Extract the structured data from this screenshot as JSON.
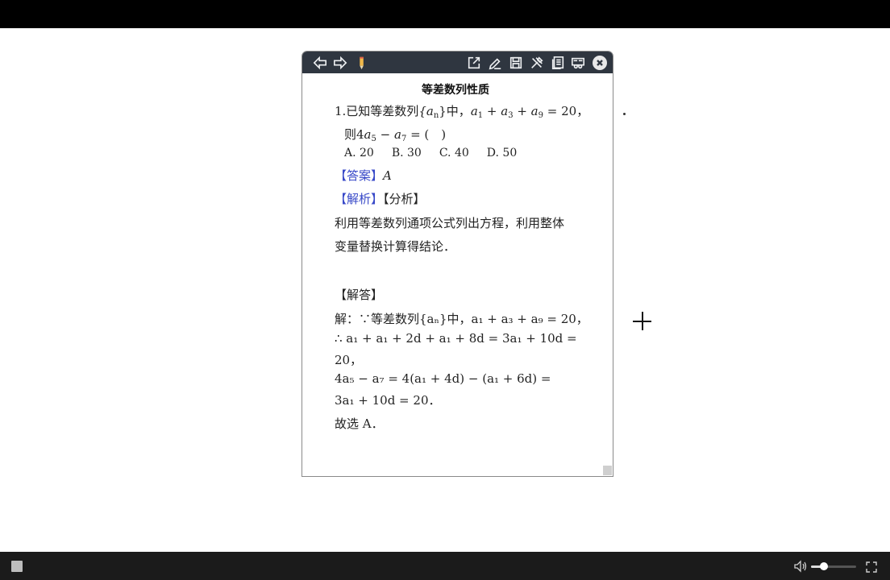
{
  "popup": {
    "toolbar_icons": [
      "arrow-left-icon",
      "arrow-right-icon",
      "pencil-icon",
      "open-external-icon",
      "edit-icon",
      "save-icon",
      "tools-icon",
      "notes-icon",
      "glasses-icon",
      "close-icon"
    ],
    "title": "等差数列性质",
    "q_prefix": "1.已知等差数列",
    "q_seq": "{a",
    "q_seq_sub": "n",
    "q_seq_end": "}中，",
    "q_eq_a": "a",
    "q_eq_1": "1",
    "q_eq_plus1": " + a",
    "q_eq_3": "3",
    "q_eq_plus2": " + a",
    "q_eq_9": "9",
    "q_eq_rhs": " = 20，",
    "q2_prefix": "则4",
    "q2_a": "a",
    "q2_5": "5",
    "q2_minus": " − a",
    "q2_7": "7",
    "q2_rhs": " = (　)",
    "options": [
      "A. 20",
      "B. 30",
      "C. 40",
      "D. 50"
    ],
    "answer_tag": "【答案】",
    "answer_value": "A",
    "analysis_tag": "【解析】",
    "analysis_sub": "【分析】",
    "analysis_line1": "利用等差数列通项公式列出方程，利用整体",
    "analysis_line2": "变量替换计算得结论．",
    "solution_tag": "【解答】",
    "sol_line1": "解：∵等差数列{aₙ}中，a₁ + a₃ + a₉ = 20，",
    "sol_line2": "∴ a₁ + a₁ + 2d + a₁ + 8d = 3a₁ + 10d =",
    "sol_line3": "20，",
    "sol_line4": "4a₅ − a₇ = 4(a₁ + 4d) − (a₁ + 6d) =",
    "sol_line5": "3a₁ + 10d = 20．",
    "sol_line6": "故选 A．"
  },
  "player": {
    "volume_fraction": 0.28
  }
}
